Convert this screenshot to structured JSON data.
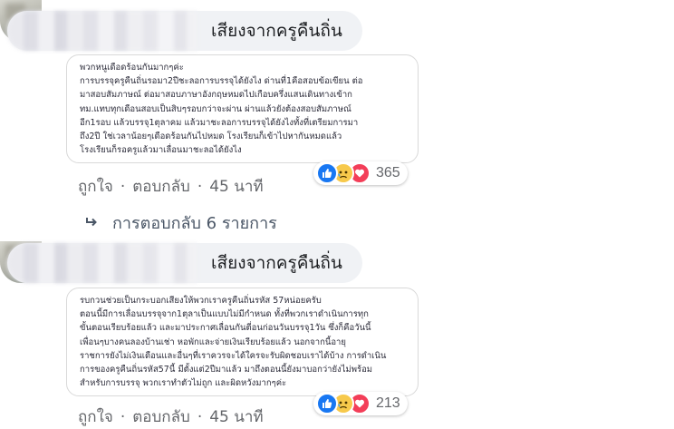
{
  "comments": [
    {
      "author": "เสียงจากครูคืนถิ่น",
      "photo_text": "พวกหนูเดือดร้อนกันมากๆค่ะ\nการบรรจุครูคืนถิ่นรอมา2ปีชะลอการบรรจุได้ยังไง ด่านที่1คือสอบข้อเขียน ต่อ\nมาสอบสัมภาษณ์ ต่อมาสอบภาษาอังกฤษหมดไปเกือบครึ่งแสนเดินทางเข้าก\nทม.แทบทุกเดือนสอบเป็นสิบๆรอบกว่าจะผ่าน ผ่านแล้วยังต้องสอบสัมภาษณ์\nอีก1รอบ แล้วบรรจุ1ตุลาคม แล้วมาชะลอการบรรจุได้ยังไงทั้งที่เตรียมการมา\nถึง2ปี ใช่เวลาน้อยๆเดือดร้อนกันไปหมด โรงเรียนก็เข้าไปหากันหมดแล้ว\nโรงเรียนก็รอครูแล้วมาเลื่อนมาชะลอได้ยังไง",
      "reaction_count": "365",
      "like_label": "ถูกใจ",
      "reply_label": "ตอบกลับ",
      "time": "45 นาที"
    },
    {
      "author": "เสียงจากครูคืนถิ่น",
      "photo_text": "รบกวนช่วยเป็นกระบอกเสียงให้พวกเราครูคืนถิ่นรหัส 57หน่อยครับ\nตอนนี้มีการเลื่อนบรรจุจาก1ตุลาเป็นแบบไม่มีกำหนด ทั้งที่พวกเราดำเนินการทุก\nขั้นตอนเรียบร้อยแล้ว และมาประกาศเลื่อนกันตี่อนก่อนวันบรรจุ1วัน ซึ่งก็คือวันนี้\nเพื่อนๆบางคนลองบ้านเช่า หอพักและจ่ายเงินเรียบร้อยแล้ว นอกจากนี้อายุ\nราชการยังไม่เงินเดือนและอื่นๆที่เราควรจะได้ใครจะรับผิดชอบเราได้บ้าง การดำเนิน\nการของครูคืนถิ่นรหัส57นี้ มีตั้งแต่2ปีมาแล้ว มาถึงตอนนี้ยังมาบอกว่ายังไม่พร้อม\nสำหรับการบรรจุ พวกเราทำตัวไม่ถูก และผิดหวังมากๆค่ะ",
      "reaction_count": "213",
      "like_label": "ถูกใจ",
      "reply_label": "ตอบกลับ",
      "time": "45 นาที"
    }
  ],
  "replies_link": "การตอบกลับ 6 รายการ",
  "icons": {
    "reply_arrow": "reply-arrow-icon",
    "like": "like-icon",
    "sad": "sad-icon",
    "love": "love-icon"
  },
  "colors": {
    "like": "#1877f2",
    "sad": "#f7c94b",
    "love": "#f33e58",
    "bubble": "#f0f2f5",
    "meta": "#65676b"
  }
}
